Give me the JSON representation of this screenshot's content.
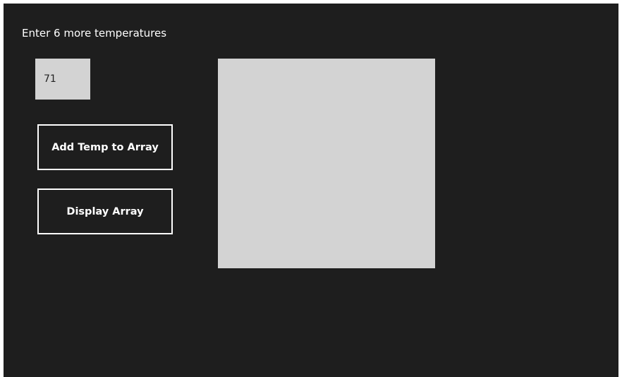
{
  "prompt": {
    "text": "Enter 6 more temperatures"
  },
  "temperature_input": {
    "value": "71"
  },
  "buttons": {
    "add_label": "Add Temp to Array",
    "display_label": "Display Array"
  },
  "output": {
    "text": ""
  },
  "colors": {
    "background": "#1e1e1e",
    "input_bg": "#d3d3d3",
    "button_border": "#ffffff",
    "text": "#ffffff"
  }
}
